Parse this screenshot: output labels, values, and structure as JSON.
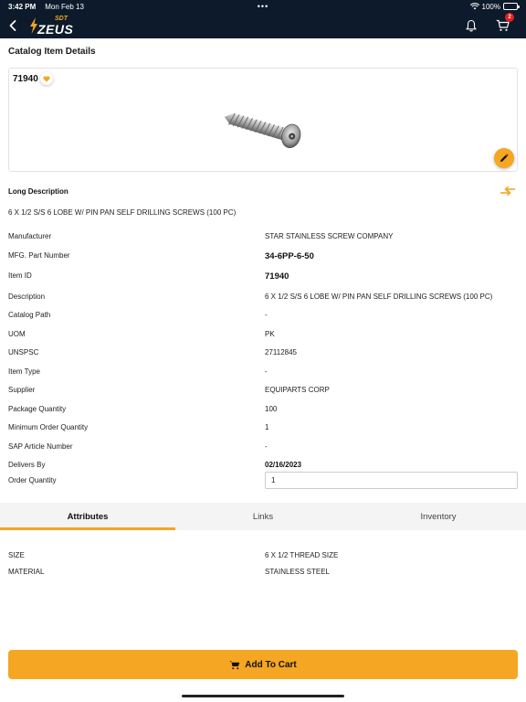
{
  "status_bar": {
    "time": "3:42 PM",
    "date": "Mon Feb 13",
    "battery": "100%"
  },
  "nav": {
    "logo_text": "ZEUS",
    "logo_sup": "SDT",
    "cart_count": "2"
  },
  "page_title": "Catalog Item Details",
  "item_card": {
    "item_number": "71940"
  },
  "long_description": {
    "label": "Long Description",
    "text": "6 X 1/2 S/S 6 LOBE W/ PIN PAN SELF DRILLING SCREWS (100 PC)"
  },
  "details": [
    {
      "label": "Manufacturer",
      "value": "STAR STAINLESS SCREW COMPANY"
    },
    {
      "label": "MFG. Part Number",
      "value": "34-6PP-6-50"
    },
    {
      "label": "Item ID",
      "value": "71940"
    },
    {
      "label": "Description",
      "value": "6 X 1/2 S/S 6 LOBE W/ PIN PAN SELF DRILLING SCREWS (100 PC)"
    },
    {
      "label": "Catalog Path",
      "value": "-"
    },
    {
      "label": "UOM",
      "value": "PK"
    },
    {
      "label": "UNSPSC",
      "value": "27112845"
    },
    {
      "label": "Item Type",
      "value": "-"
    },
    {
      "label": "Supplier",
      "value": "EQUIPARTS CORP"
    },
    {
      "label": "Package Quantity",
      "value": "100"
    },
    {
      "label": "Minimum Order Quantity",
      "value": "1"
    },
    {
      "label": "SAP Article Number",
      "value": "-"
    },
    {
      "label": "Delivers By",
      "value": "02/16/2023"
    }
  ],
  "order_quantity": {
    "label": "Order Quantity",
    "value": "1"
  },
  "tabs": [
    {
      "label": "Attributes",
      "active": true
    },
    {
      "label": "Links",
      "active": false
    },
    {
      "label": "Inventory",
      "active": false
    }
  ],
  "attributes": [
    {
      "label": "SIZE",
      "value": "6 X 1/2 THREAD SIZE"
    },
    {
      "label": "MATERIAL",
      "value": "STAINLESS STEEL"
    }
  ],
  "add_to_cart_label": "Add To Cart",
  "colors": {
    "accent": "#f5a623",
    "nav_bg": "#0d1a2b",
    "badge": "#e02020"
  }
}
